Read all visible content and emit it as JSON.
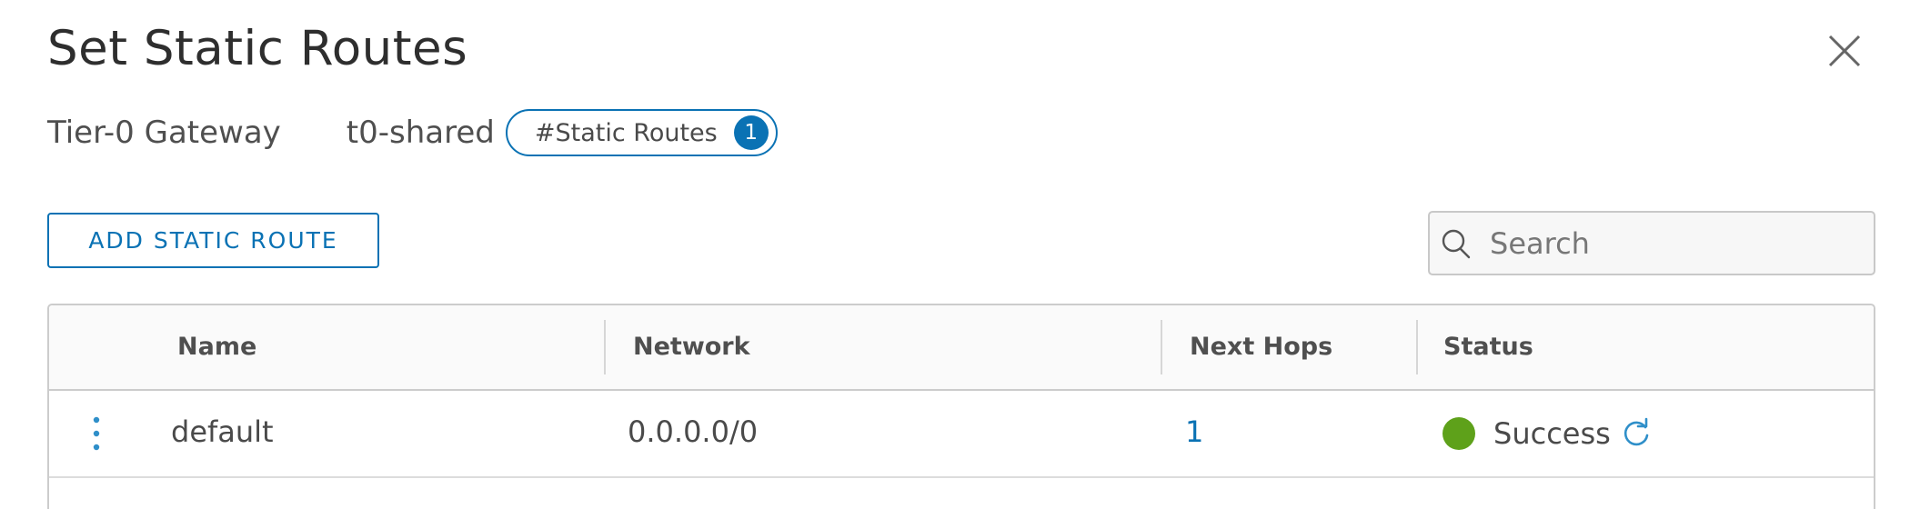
{
  "dialog": {
    "title": "Set Static Routes"
  },
  "meta": {
    "gateway_label": "Tier-0 Gateway",
    "gateway_value": "t0-shared",
    "badge_label": "#Static Routes",
    "badge_count": "1"
  },
  "toolbar": {
    "add_label": "ADD STATIC ROUTE",
    "search_placeholder": "Search"
  },
  "table": {
    "headers": {
      "name": "Name",
      "network": "Network",
      "next_hops": "Next Hops",
      "status": "Status"
    },
    "rows": [
      {
        "name": "default",
        "network": "0.0.0.0/0",
        "next_hops": "1",
        "status": "Success"
      }
    ]
  },
  "colors": {
    "accent": "#0a72b4",
    "success": "#5ea11a",
    "border": "#cccccc"
  },
  "icons": {
    "close": "close-icon",
    "search": "search-icon",
    "row_menu": "vertical-dots-icon",
    "status": "status-dot-icon",
    "refresh": "refresh-icon"
  }
}
